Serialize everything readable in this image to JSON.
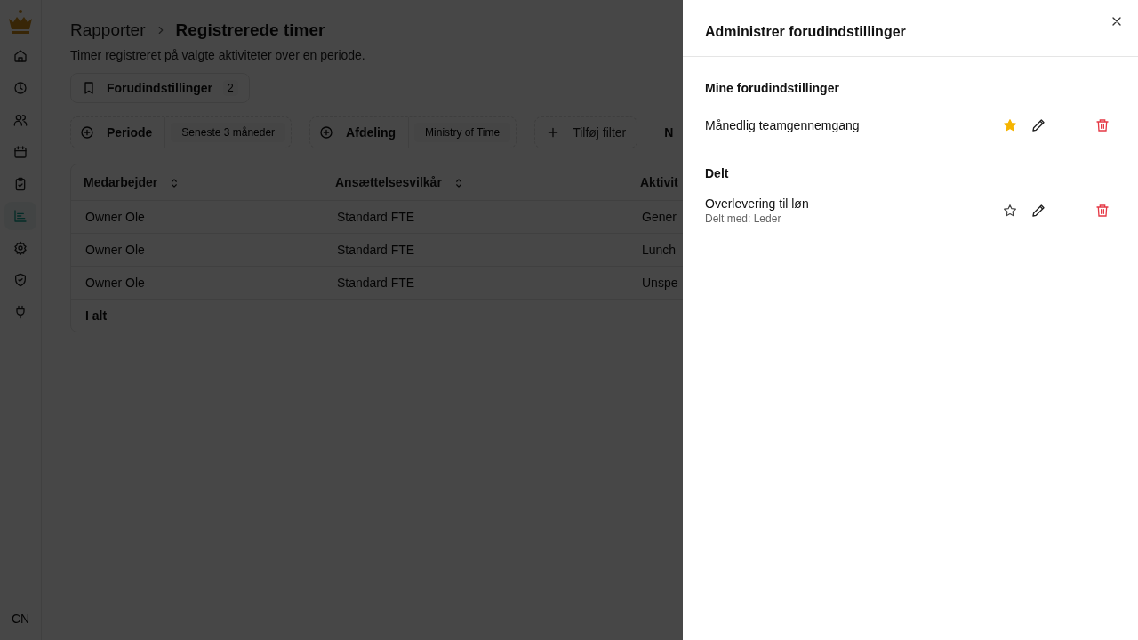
{
  "sidebar": {
    "items": [
      {
        "selected": false
      },
      {
        "selected": false
      },
      {
        "selected": false
      },
      {
        "selected": false
      },
      {
        "selected": false
      },
      {
        "selected": true
      },
      {
        "selected": false
      },
      {
        "selected": false
      },
      {
        "selected": false
      }
    ],
    "user_initials": "CN"
  },
  "breadcrumb": {
    "parent": "Rapporter",
    "current": "Registrerede timer"
  },
  "subtitle": "Timer registreret på valgte aktiviteter over en periode.",
  "presets_button": {
    "label": "Forudindstillinger",
    "count": "2"
  },
  "filters": [
    {
      "kind": "chip",
      "label": "Periode",
      "value": "Seneste 3 måneder"
    },
    {
      "kind": "chip",
      "label": "Afdeling",
      "value": "Ministry of Time"
    },
    {
      "kind": "add",
      "label": "Tilføj filter"
    },
    {
      "kind": "text",
      "label": "N"
    }
  ],
  "table": {
    "columns": [
      {
        "label": "Medarbejder",
        "sortable": true
      },
      {
        "label": "Ansættelsesvilkår",
        "sortable": true
      },
      {
        "label": "Aktivit"
      }
    ],
    "rows": [
      [
        "Owner Ole",
        "Standard FTE",
        "Gener"
      ],
      [
        "Owner Ole",
        "Standard FTE",
        "Lunch"
      ],
      [
        "Owner Ole",
        "Standard FTE",
        "Unspe"
      ]
    ],
    "total_label": "I alt"
  },
  "drawer": {
    "title": "Administrer forudindstillinger",
    "sections": [
      {
        "title": "Mine forudindstillinger",
        "presets": [
          {
            "name": "Månedlig teamgennemgang",
            "favorite": true
          }
        ]
      },
      {
        "title": "Delt",
        "presets": [
          {
            "name": "Overlevering til løn",
            "shared_with": "Delt med: Leder",
            "favorite": false
          }
        ]
      }
    ]
  }
}
